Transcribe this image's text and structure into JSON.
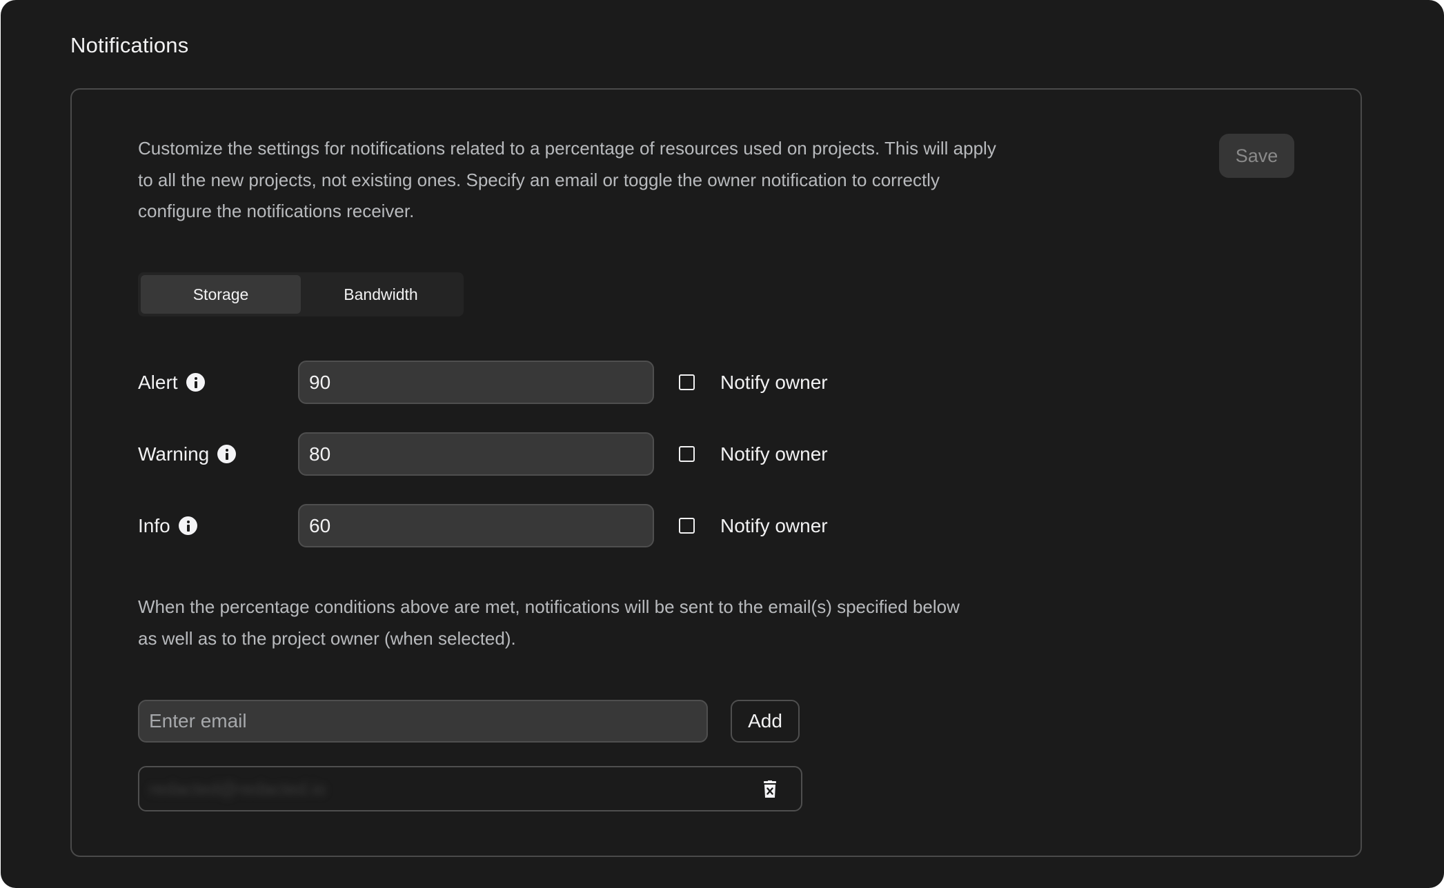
{
  "page": {
    "title": "Notifications"
  },
  "card": {
    "description": "Customize the settings for notifications related to a percentage of resources used on projects. This will apply to all the new projects, not existing ones. Specify an email or toggle the owner notification to correctly configure the notifications receiver.",
    "save_label": "Save",
    "tabs": [
      {
        "label": "Storage",
        "active": true
      },
      {
        "label": "Bandwidth",
        "active": false
      }
    ],
    "thresholds": [
      {
        "label": "Alert",
        "icon": "info-icon",
        "value": "90",
        "notify_label": "Notify owner",
        "notify_checked": false
      },
      {
        "label": "Warning",
        "icon": "info-icon",
        "value": "80",
        "notify_label": "Notify owner",
        "notify_checked": false
      },
      {
        "label": "Info",
        "icon": "info-icon",
        "value": "60",
        "notify_label": "Notify owner",
        "notify_checked": false
      }
    ],
    "recipients_description": "When the percentage conditions above are met, notifications will be sent to the email(s) specified below as well as to the project owner (when selected).",
    "email_input": {
      "value": "",
      "placeholder": "Enter email"
    },
    "add_label": "Add",
    "emails": [
      {
        "address": "redacted@redacted.io",
        "blurred": true,
        "delete_icon": "trash-icon"
      }
    ]
  },
  "colors": {
    "background": "#1b1b1b",
    "text_primary": "#f2f2f3",
    "text_secondary": "#b8babd",
    "input_bg": "#383838",
    "border": "#4f4f4f",
    "save_disabled_bg": "#363636",
    "save_disabled_text": "#8a8a8a"
  }
}
